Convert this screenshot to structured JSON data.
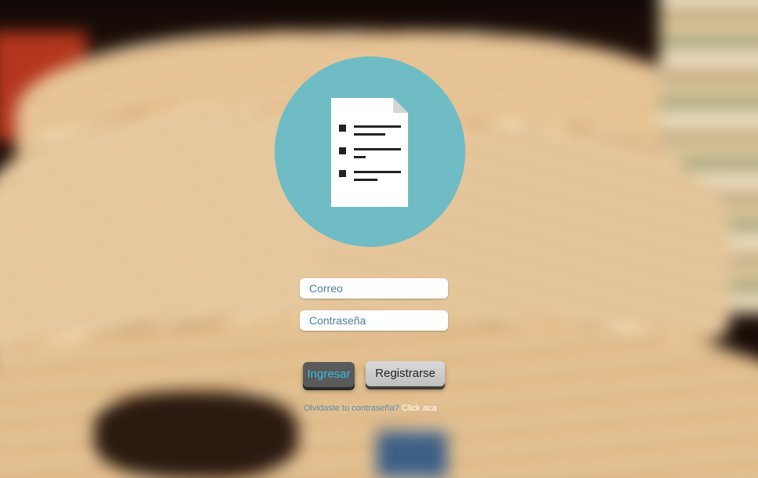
{
  "login": {
    "email_placeholder": "Correo",
    "password_placeholder": "Contraseña",
    "login_label": "Ingresar",
    "register_label": "Registrarse",
    "forgot_text": "Olvidaste tu contraseña?",
    "forgot_link": "Click aca"
  },
  "logo": {
    "icon": "document-list-icon",
    "circle_color": "#6fbcc4"
  },
  "colors": {
    "login_text": "#36bbe6",
    "login_bg": "#5a5a5a",
    "register_bg": "#cfcfcf",
    "field_text": "#4c7f99"
  }
}
